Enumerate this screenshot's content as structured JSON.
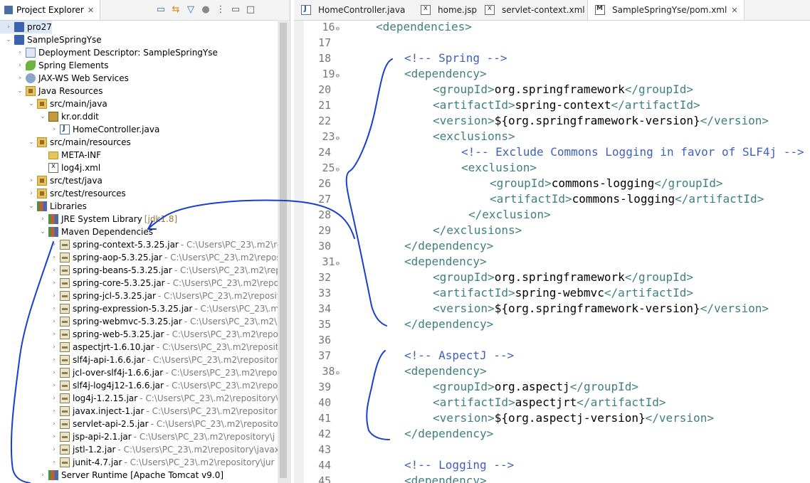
{
  "explorer": {
    "title": "Project Explorer",
    "close": "✕",
    "tree": [
      {
        "text": "pro27",
        "indent": 0,
        "arrow": "›",
        "icon": "proj",
        "bg": "#dde8f7"
      },
      {
        "text": "SampleSpringYse",
        "indent": 0,
        "arrow": "⌄",
        "icon": "proj"
      },
      {
        "text": "Deployment Descriptor: SampleSpringYse",
        "indent": 1,
        "arrow": "›",
        "icon": "dd"
      },
      {
        "text": "Spring Elements",
        "indent": 1,
        "arrow": "›",
        "icon": "spring"
      },
      {
        "text": "JAX-WS Web Services",
        "indent": 1,
        "arrow": "›",
        "icon": "ws"
      },
      {
        "text": "Java Resources",
        "indent": 1,
        "arrow": "⌄",
        "icon": "pkgfolder"
      },
      {
        "text": "src/main/java",
        "indent": 2,
        "arrow": "⌄",
        "icon": "pkgfolder"
      },
      {
        "text": "kr.or.ddit",
        "indent": 3,
        "arrow": "⌄",
        "icon": "pkg"
      },
      {
        "text": "HomeController.java",
        "indent": 4,
        "arrow": "›",
        "icon": "java"
      },
      {
        "text": "src/main/resources",
        "indent": 2,
        "arrow": "⌄",
        "icon": "pkgfolder"
      },
      {
        "text": "META-INF",
        "indent": 3,
        "arrow": "",
        "icon": "folder"
      },
      {
        "text": "log4j.xml",
        "indent": 3,
        "arrow": "",
        "icon": "xml"
      },
      {
        "text": "src/test/java",
        "indent": 2,
        "arrow": "›",
        "icon": "pkgfolder"
      },
      {
        "text": "src/test/resources",
        "indent": 2,
        "arrow": "›",
        "icon": "pkgfolder"
      },
      {
        "text": "Libraries",
        "indent": 2,
        "arrow": "⌄",
        "icon": "lib"
      },
      {
        "text": "JRE System Library",
        "deco": "[jdk1.8]",
        "indent": 3,
        "arrow": "›",
        "icon": "lib"
      },
      {
        "text": "Maven Dependencies",
        "indent": 3,
        "arrow": "⌄",
        "icon": "lib"
      },
      {
        "text": "spring-context-5.3.25.jar",
        "path": "- C:\\Users\\PC_23\\.m2\\re",
        "indent": 4,
        "arrow": "›",
        "icon": "jar"
      },
      {
        "text": "spring-aop-5.3.25.jar",
        "path": "- C:\\Users\\PC_23\\.m2\\repos",
        "indent": 4,
        "arrow": "›",
        "icon": "jar"
      },
      {
        "text": "spring-beans-5.3.25.jar",
        "path": "- C:\\Users\\PC_23\\.m2\\repo",
        "indent": 4,
        "arrow": "›",
        "icon": "jar"
      },
      {
        "text": "spring-core-5.3.25.jar",
        "path": "- C:\\Users\\PC_23\\.m2\\repo",
        "indent": 4,
        "arrow": "›",
        "icon": "jar"
      },
      {
        "text": "spring-jcl-5.3.25.jar",
        "path": "- C:\\Users\\PC_23\\.m2\\reposit",
        "indent": 4,
        "arrow": "›",
        "icon": "jar"
      },
      {
        "text": "spring-expression-5.3.25.jar",
        "path": "- C:\\Users\\PC_23\\.m2",
        "indent": 4,
        "arrow": "›",
        "icon": "jar"
      },
      {
        "text": "spring-webmvc-5.3.25.jar",
        "path": "- C:\\Users\\PC_23\\.m2\\rep",
        "indent": 4,
        "arrow": "›",
        "icon": "jar"
      },
      {
        "text": "spring-web-5.3.25.jar",
        "path": "- C:\\Users\\PC_23\\.m2\\repo",
        "indent": 4,
        "arrow": "›",
        "icon": "jar"
      },
      {
        "text": "aspectjrt-1.6.10.jar",
        "path": "- C:\\Users\\PC_23\\.m2\\reposito",
        "indent": 4,
        "arrow": "›",
        "icon": "jar"
      },
      {
        "text": "slf4j-api-1.6.6.jar",
        "path": "- C:\\Users\\PC_23\\.m2\\repositor",
        "indent": 4,
        "arrow": "›",
        "icon": "jar"
      },
      {
        "text": "jcl-over-slf4j-1.6.6.jar",
        "path": "- C:\\Users\\PC_23\\.m2\\repo",
        "indent": 4,
        "arrow": "›",
        "icon": "jar"
      },
      {
        "text": "slf4j-log4j12-1.6.6.jar",
        "path": "- C:\\Users\\PC_23\\.m2\\repo",
        "indent": 4,
        "arrow": "›",
        "icon": "jar"
      },
      {
        "text": "log4j-1.2.15.jar",
        "path": "- C:\\Users\\PC_23\\.m2\\repository\\",
        "indent": 4,
        "arrow": "›",
        "icon": "jar"
      },
      {
        "text": "javax.inject-1.jar",
        "path": "- C:\\Users\\PC_23\\.m2\\repository",
        "indent": 4,
        "arrow": "›",
        "icon": "jar"
      },
      {
        "text": "servlet-api-2.5.jar",
        "path": "- C:\\Users\\PC_23\\.m2\\repository",
        "indent": 4,
        "arrow": "›",
        "icon": "jar"
      },
      {
        "text": "jsp-api-2.1.jar",
        "path": "- C:\\Users\\PC_23\\.m2\\repository\\j",
        "indent": 4,
        "arrow": "›",
        "icon": "jar"
      },
      {
        "text": "jstl-1.2.jar",
        "path": "- C:\\Users\\PC_23\\.m2\\repository\\javax",
        "indent": 4,
        "arrow": "›",
        "icon": "jar"
      },
      {
        "text": "junit-4.7.jar",
        "path": "- C:\\Users\\PC_23\\.m2\\repository\\jur",
        "indent": 4,
        "arrow": "›",
        "icon": "jar"
      },
      {
        "text": "Server Runtime [Apache Tomcat v9.0]",
        "indent": 3,
        "arrow": "›",
        "icon": "lib"
      }
    ]
  },
  "editor": {
    "tabs": [
      {
        "label": "HomeController.java",
        "icon": "java",
        "active": false
      },
      {
        "label": "home.jsp",
        "icon": "xml",
        "active": false
      },
      {
        "label": "servlet-context.xml",
        "icon": "xml",
        "active": false
      },
      {
        "label": "SampleSpringYse/pom.xml",
        "icon": "m",
        "active": true,
        "close": "✕"
      }
    ],
    "lines": [
      {
        "n": "16",
        "fold": true,
        "indent": 1,
        "parts": [
          [
            "tag",
            "<dependencies>"
          ]
        ]
      },
      {
        "n": "17",
        "indent": 0,
        "parts": []
      },
      {
        "n": "18",
        "indent": 2,
        "parts": [
          [
            "cm",
            "<!-- Spring -->"
          ]
        ]
      },
      {
        "n": "19",
        "fold": true,
        "indent": 2,
        "parts": [
          [
            "tag",
            "<dependency>"
          ]
        ]
      },
      {
        "n": "20",
        "indent": 3,
        "parts": [
          [
            "tag",
            "<groupId>"
          ],
          [
            "txt",
            "org.springframework"
          ],
          [
            "tag",
            "</groupId>"
          ]
        ]
      },
      {
        "n": "21",
        "indent": 3,
        "parts": [
          [
            "tag",
            "<artifactId>"
          ],
          [
            "txt",
            "spring-context"
          ],
          [
            "tag",
            "</artifactId>"
          ]
        ]
      },
      {
        "n": "22",
        "indent": 3,
        "parts": [
          [
            "tag",
            "<version>"
          ],
          [
            "txt",
            "${org.springframework-version}"
          ],
          [
            "tag",
            "</version>"
          ]
        ]
      },
      {
        "n": "23",
        "fold": true,
        "indent": 3,
        "parts": [
          [
            "tag",
            "<exclusions>"
          ]
        ]
      },
      {
        "n": "24",
        "indent": 4,
        "parts": [
          [
            "cm",
            "<!-- Exclude Commons Logging in favor of SLF4j -->"
          ]
        ]
      },
      {
        "n": "25",
        "fold": true,
        "indent": 4,
        "parts": [
          [
            "tag",
            "<exclusion>"
          ]
        ]
      },
      {
        "n": "26",
        "indent": 5,
        "parts": [
          [
            "tag",
            "<groupId>"
          ],
          [
            "txt",
            "commons-logging"
          ],
          [
            "tag",
            "</groupId>"
          ]
        ]
      },
      {
        "n": "27",
        "indent": 5,
        "parts": [
          [
            "tag",
            "<artifactId>"
          ],
          [
            "txt",
            "commons-logging"
          ],
          [
            "tag",
            "</artifactId>"
          ]
        ]
      },
      {
        "n": "28",
        "indent": 4,
        "extra": " ",
        "parts": [
          [
            "tag",
            "</exclusion>"
          ]
        ]
      },
      {
        "n": "29",
        "indent": 3,
        "parts": [
          [
            "tag",
            "</exclusions>"
          ]
        ]
      },
      {
        "n": "30",
        "indent": 2,
        "parts": [
          [
            "tag",
            "</dependency>"
          ]
        ]
      },
      {
        "n": "31",
        "fold": true,
        "indent": 2,
        "parts": [
          [
            "tag",
            "<dependency>"
          ]
        ]
      },
      {
        "n": "32",
        "indent": 3,
        "parts": [
          [
            "tag",
            "<groupId>"
          ],
          [
            "txt",
            "org.springframework"
          ],
          [
            "tag",
            "</groupId>"
          ]
        ]
      },
      {
        "n": "33",
        "indent": 3,
        "parts": [
          [
            "tag",
            "<artifactId>"
          ],
          [
            "txt",
            "spring-webmvc"
          ],
          [
            "tag",
            "</artifactId>"
          ]
        ]
      },
      {
        "n": "34",
        "indent": 3,
        "parts": [
          [
            "tag",
            "<version>"
          ],
          [
            "txt",
            "${org.springframework-version}"
          ],
          [
            "tag",
            "</version>"
          ]
        ]
      },
      {
        "n": "35",
        "indent": 2,
        "parts": [
          [
            "tag",
            "</dependency>"
          ]
        ]
      },
      {
        "n": "36",
        "indent": 0,
        "parts": []
      },
      {
        "n": "37",
        "indent": 2,
        "parts": [
          [
            "cm",
            "<!-- AspectJ -->"
          ]
        ]
      },
      {
        "n": "38",
        "fold": true,
        "indent": 2,
        "parts": [
          [
            "tag",
            "<dependency>"
          ]
        ]
      },
      {
        "n": "39",
        "indent": 3,
        "parts": [
          [
            "tag",
            "<groupId>"
          ],
          [
            "txt",
            "org.aspectj"
          ],
          [
            "tag",
            "</groupId>"
          ]
        ]
      },
      {
        "n": "40",
        "indent": 3,
        "parts": [
          [
            "tag",
            "<artifactId>"
          ],
          [
            "txt",
            "aspectjrt"
          ],
          [
            "tag",
            "</artifactId>"
          ]
        ]
      },
      {
        "n": "41",
        "indent": 3,
        "parts": [
          [
            "tag",
            "<version>"
          ],
          [
            "txt",
            "${org.aspectj-version}"
          ],
          [
            "tag",
            "</version>"
          ]
        ]
      },
      {
        "n": "42",
        "indent": 2,
        "parts": [
          [
            "tag",
            "</dependency>"
          ]
        ]
      },
      {
        "n": "43",
        "indent": 0,
        "parts": []
      },
      {
        "n": "44",
        "indent": 2,
        "parts": [
          [
            "cm",
            "<!-- Logging -->"
          ]
        ]
      },
      {
        "n": "45",
        "indent": 2,
        "parts": [
          [
            "tag",
            "<dependency>"
          ]
        ]
      }
    ]
  },
  "colors": {
    "tag": "#3f7f7f",
    "comment": "#3f5fbf",
    "ink": "#1a3fd0"
  }
}
